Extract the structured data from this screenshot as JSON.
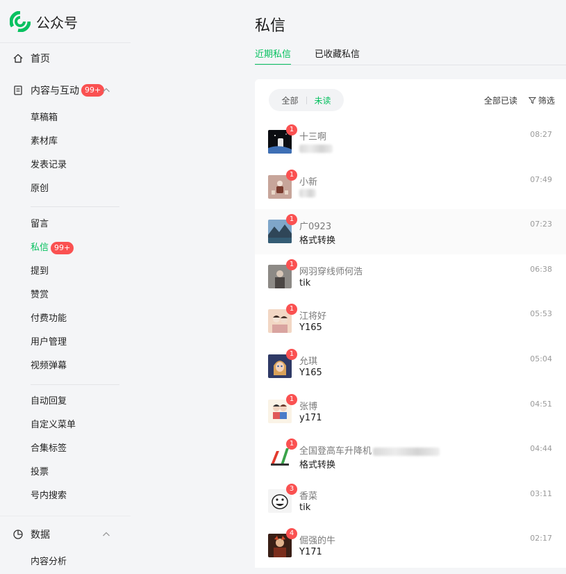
{
  "brand": {
    "title": "公众号"
  },
  "nav": {
    "home": "首页",
    "content_group": {
      "label": "内容与互动",
      "badge": "99+"
    },
    "content_items": [
      "草稿箱",
      "素材库",
      "发表记录",
      "原创"
    ],
    "interact_items": [
      {
        "label": "留言"
      },
      {
        "label": "私信",
        "badge": "99+"
      },
      {
        "label": "提到"
      },
      {
        "label": "赞赏"
      },
      {
        "label": "付费功能"
      },
      {
        "label": "用户管理"
      },
      {
        "label": "视频弹幕"
      }
    ],
    "tool_items": [
      "自动回复",
      "自定义菜单",
      "合集标签",
      "投票",
      "号内搜索"
    ],
    "data_group": {
      "label": "数据"
    },
    "data_items": [
      "内容分析"
    ]
  },
  "main": {
    "title": "私信",
    "tabs": [
      "近期私信",
      "已收藏私信"
    ],
    "filter": {
      "all": "全部",
      "unread": "未读"
    },
    "actions": {
      "mark_all_read": "全部已读",
      "filter": "筛选"
    },
    "messages": [
      {
        "name": "十三啊",
        "text": "",
        "time": "08:27",
        "unread": "1"
      },
      {
        "name": "小新",
        "text": "",
        "time": "07:49",
        "unread": "1"
      },
      {
        "name": "广0923",
        "text": "格式转换",
        "time": "07:23",
        "unread": "1"
      },
      {
        "name": "网羽穿线师何浩",
        "text": "tik",
        "time": "06:38",
        "unread": "1"
      },
      {
        "name": "江将好",
        "text": "Y165",
        "time": "05:53",
        "unread": "1"
      },
      {
        "name": "允琪",
        "text": "Y165",
        "time": "05:04",
        "unread": "1"
      },
      {
        "name": "张博",
        "text": "y171",
        "time": "04:51",
        "unread": "1"
      },
      {
        "name": "全国登高车升降机",
        "text": "格式转换",
        "time": "04:44",
        "unread": "1"
      },
      {
        "name": "香菜",
        "text": "tik",
        "time": "03:11",
        "unread": "3"
      },
      {
        "name": "倔强的牛",
        "text": "Y171",
        "time": "02:17",
        "unread": "4"
      }
    ]
  },
  "colors": {
    "accent": "#07c160",
    "badge": "#fa5151"
  }
}
